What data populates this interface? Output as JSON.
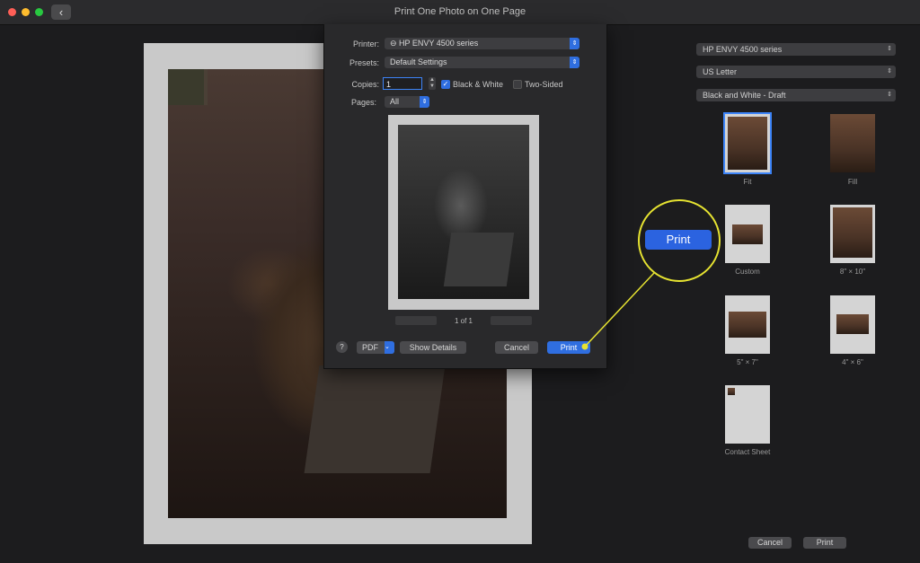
{
  "window": {
    "title": "Print One Photo on One Page",
    "back_glyph": "‹",
    "traffic_colors": [
      "#ff5f57",
      "#febc2e",
      "#28c840"
    ]
  },
  "dialog": {
    "printer_label": "Printer:",
    "printer_value": "HP ENVY 4500 series",
    "presets_label": "Presets:",
    "presets_value": "Default Settings",
    "copies_label": "Copies:",
    "copies_value": "1",
    "bw_label": "Black & White",
    "bw_checked": true,
    "two_sided_label": "Two-Sided",
    "two_sided_checked": false,
    "pages_label": "Pages:",
    "pages_value": "All",
    "page_count": "1 of 1",
    "help_glyph": "?",
    "pdf_label": "PDF",
    "show_details_label": "Show Details",
    "cancel_label": "Cancel",
    "print_label": "Print"
  },
  "panel": {
    "printer_value": "HP ENVY 4500 series",
    "paper_value": "US Letter",
    "quality_value": "Black and White - Draft",
    "layouts": [
      {
        "label": "Fit",
        "selected": true
      },
      {
        "label": "Fill",
        "selected": false
      },
      {
        "label": "Custom",
        "selected": false
      },
      {
        "label": "8\" × 10\"",
        "selected": false
      },
      {
        "label": "5\" × 7\"",
        "selected": false
      },
      {
        "label": "4\" × 6\"",
        "selected": false
      },
      {
        "label": "Contact Sheet",
        "selected": false
      }
    ],
    "cancel_label": "Cancel",
    "print_label": "Print"
  },
  "callout": {
    "label": "Print",
    "color": "#e6e331"
  },
  "colors": {
    "accent": "#2f6ee0",
    "background": "#1c1c1e"
  }
}
